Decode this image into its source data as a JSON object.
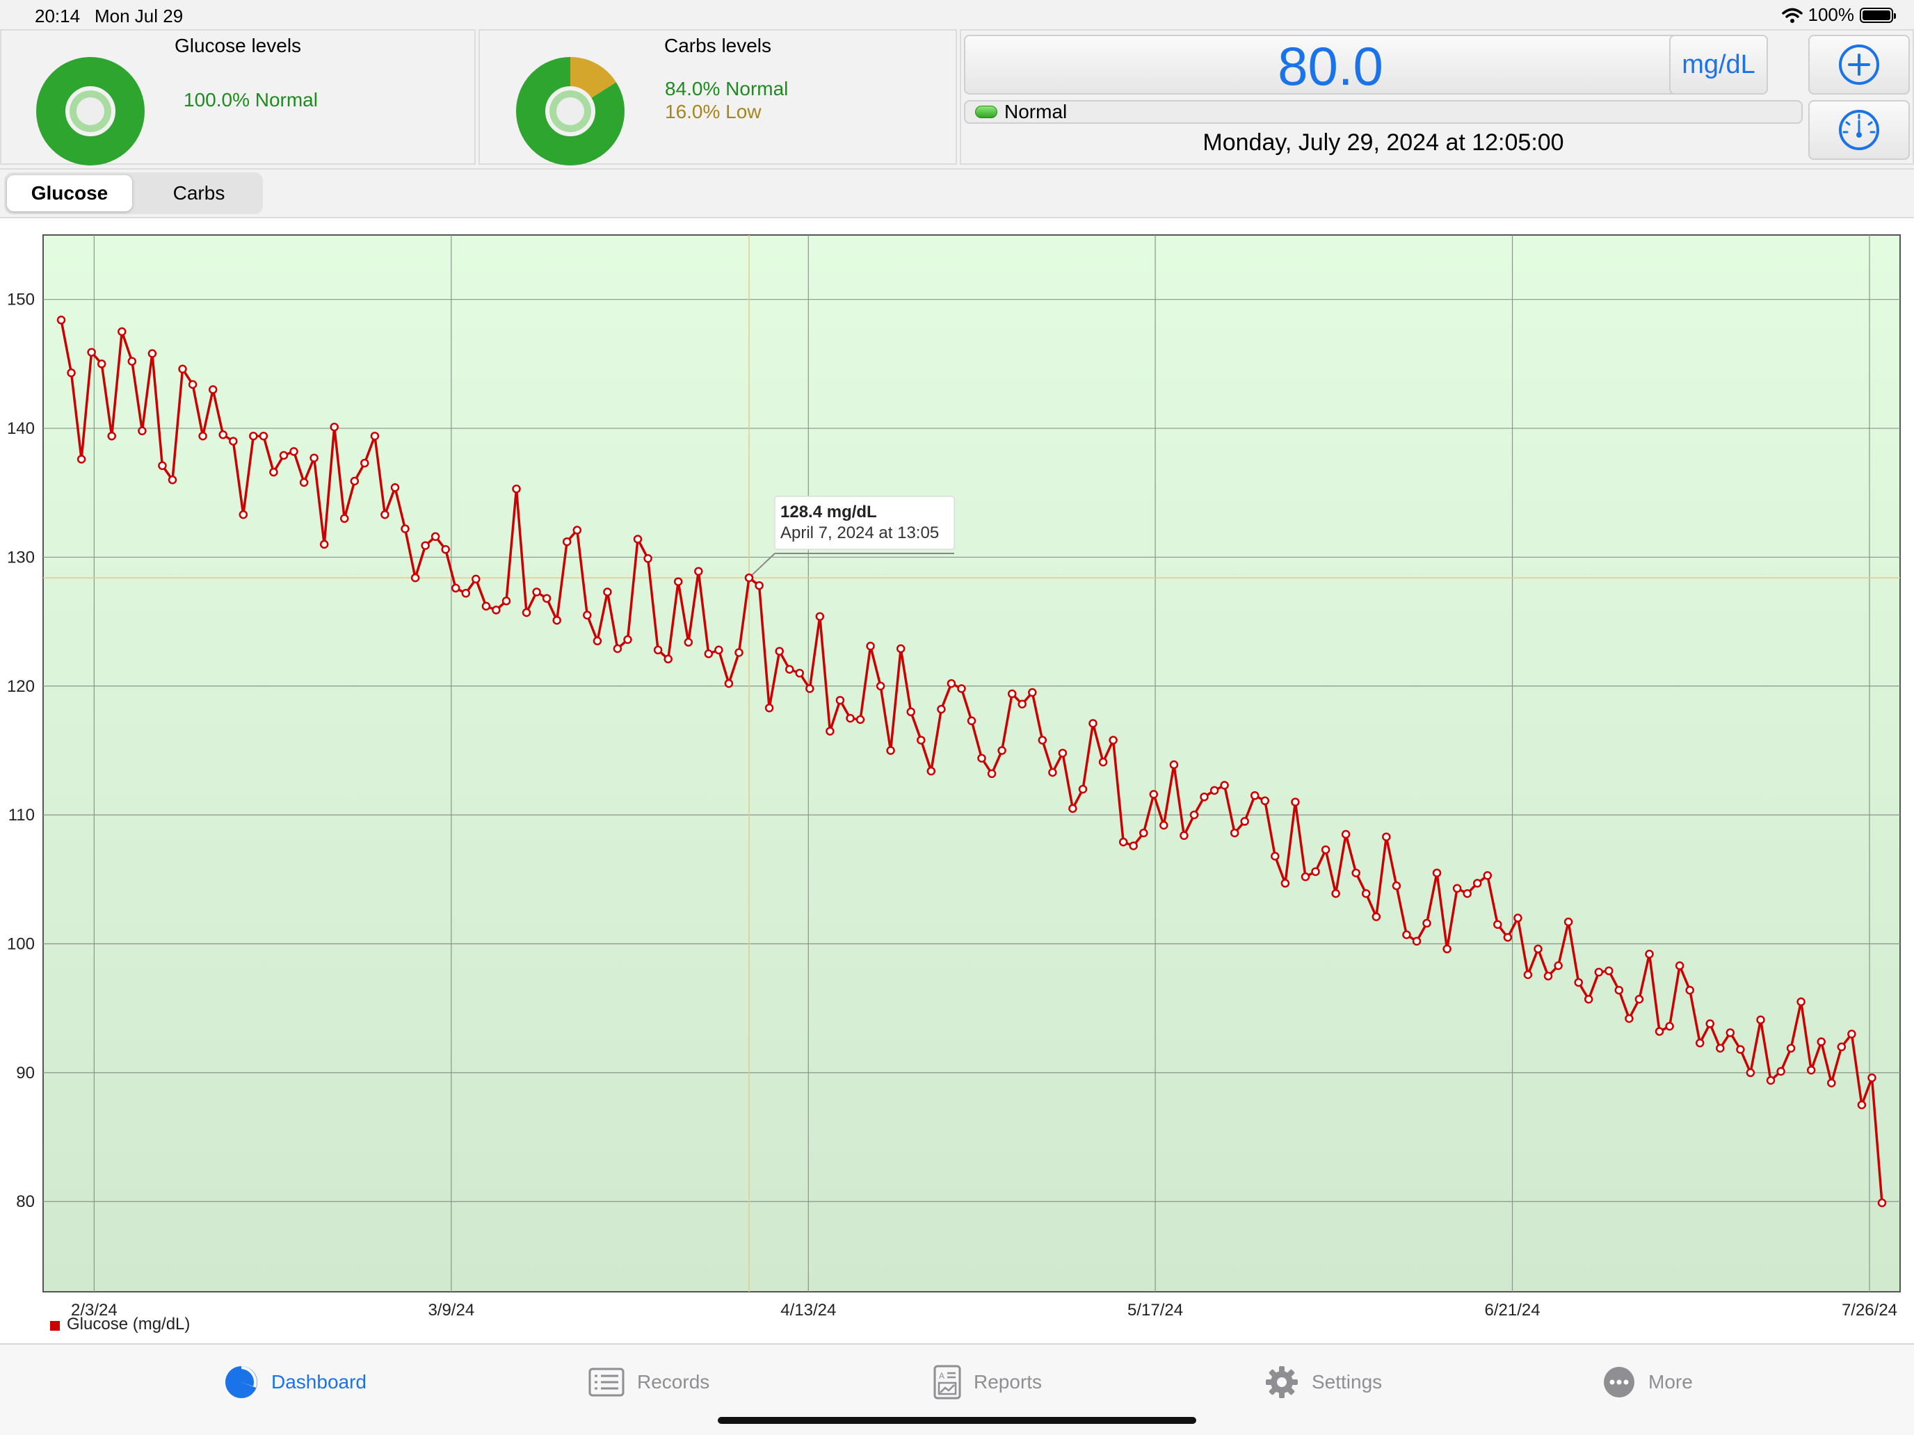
{
  "status_bar": {
    "time": "20:14",
    "date": "Mon Jul 29",
    "battery": "100%"
  },
  "glucose_panel": {
    "title": "Glucose levels",
    "normal_text": "100.0% Normal",
    "normal_fraction": 1.0
  },
  "carbs_panel": {
    "title": "Carbs levels",
    "normal_text": "84.0% Normal",
    "low_text": "16.0% Low",
    "normal_fraction": 0.84,
    "low_fraction": 0.16
  },
  "reading": {
    "value": "80.0",
    "unit": "mg/dL",
    "status": "Normal",
    "datetime": "Monday, July 29, 2024 at 12:05:00"
  },
  "segments": [
    "Glucose",
    "Carbs"
  ],
  "colors": {
    "accent": "#1a73e8",
    "normal_green": "#2ea52e",
    "low_gold": "#d4a72c",
    "series_red": "#cc0000"
  },
  "tabbar": {
    "items": [
      {
        "label": "Dashboard",
        "icon": "dashboard-pie-icon",
        "active": true
      },
      {
        "label": "Records",
        "icon": "records-list-icon",
        "active": false
      },
      {
        "label": "Reports",
        "icon": "reports-doc-icon",
        "active": false
      },
      {
        "label": "Settings",
        "icon": "settings-gear-icon",
        "active": false
      },
      {
        "label": "More",
        "icon": "more-ellipsis-icon",
        "active": false
      }
    ]
  },
  "chart_data": {
    "type": "line",
    "title": "",
    "xlabel": "",
    "ylabel": "",
    "ylim": [
      73,
      155
    ],
    "yticks": [
      80,
      90,
      100,
      110,
      120,
      130,
      140,
      150
    ],
    "xticks": [
      "2/3/24",
      "3/9/24",
      "4/13/24",
      "5/17/24",
      "6/21/24",
      "7/26/24"
    ],
    "x_range": [
      "2024-01-29",
      "2024-07-29"
    ],
    "legend": "bottom-left",
    "grid": true,
    "series": [
      {
        "name": "Glucose (mg/dL)",
        "values": [
          148.4,
          144.3,
          137.6,
          145.9,
          145.0,
          139.4,
          147.5,
          145.2,
          139.8,
          145.8,
          137.1,
          136.0,
          144.6,
          143.4,
          139.4,
          143.0,
          139.5,
          139.0,
          133.3,
          139.4,
          139.4,
          136.6,
          137.9,
          138.2,
          135.8,
          137.7,
          131.0,
          140.1,
          133.0,
          135.9,
          137.3,
          139.4,
          133.3,
          135.4,
          132.2,
          128.4,
          130.9,
          131.6,
          130.6,
          127.6,
          127.2,
          128.3,
          126.2,
          125.9,
          126.6,
          135.3,
          125.7,
          127.3,
          126.8,
          125.1,
          131.2,
          132.1,
          125.5,
          123.5,
          127.3,
          122.9,
          123.6,
          131.4,
          129.9,
          122.8,
          122.1,
          128.1,
          123.4,
          128.9,
          122.5,
          122.8,
          120.2,
          122.6,
          128.4,
          127.8,
          118.3,
          122.7,
          121.3,
          121.0,
          119.8,
          125.4,
          116.5,
          118.9,
          117.5,
          117.4,
          123.1,
          120.0,
          115.0,
          122.9,
          118.0,
          115.8,
          113.4,
          118.2,
          120.2,
          119.8,
          117.3,
          114.4,
          113.2,
          115.0,
          119.4,
          118.6,
          119.5,
          115.8,
          113.3,
          114.8,
          110.5,
          112.0,
          117.1,
          114.1,
          115.8,
          107.9,
          107.6,
          108.6,
          111.6,
          109.2,
          113.9,
          108.4,
          110.0,
          111.4,
          111.9,
          112.3,
          108.6,
          109.5,
          111.5,
          111.1,
          106.8,
          104.7,
          111.0,
          105.2,
          105.6,
          107.3,
          103.9,
          108.5,
          105.5,
          103.9,
          102.1,
          108.3,
          104.5,
          100.7,
          100.2,
          101.6,
          105.5,
          99.6,
          104.3,
          103.9,
          104.7,
          105.3,
          101.5,
          100.5,
          102.0,
          97.6,
          99.6,
          97.5,
          98.3,
          101.7,
          97.0,
          95.7,
          97.8,
          97.9,
          96.4,
          94.2,
          95.7,
          99.2,
          93.2,
          93.6,
          98.3,
          96.4,
          92.3,
          93.8,
          91.9,
          93.1,
          91.8,
          90.0,
          94.1,
          89.4,
          90.1,
          91.9,
          95.5,
          90.2,
          92.4,
          89.2,
          92.0,
          93.0,
          87.5,
          89.6,
          79.9
        ]
      }
    ],
    "annotations": [
      {
        "value_text": "128.4 mg/dL",
        "date_text": "April 7, 2024 at 13:05"
      }
    ]
  }
}
